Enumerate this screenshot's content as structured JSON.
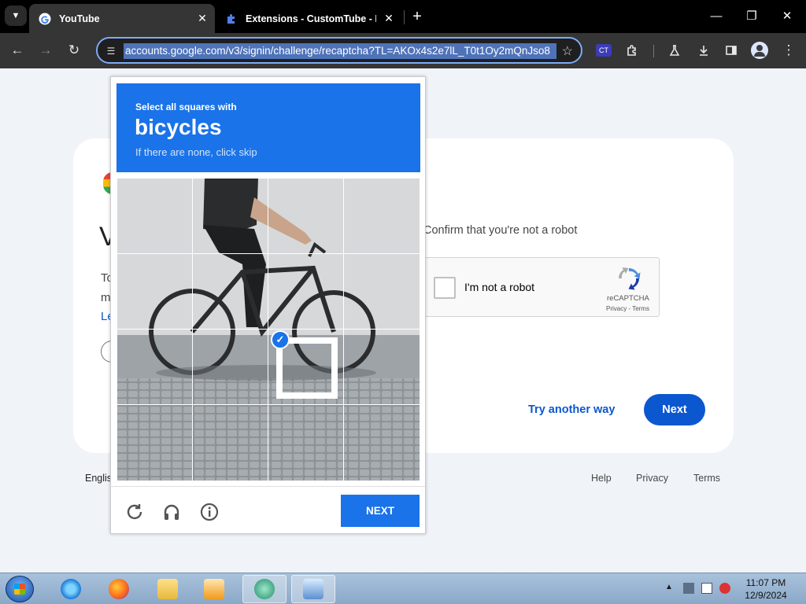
{
  "browser": {
    "tabs": [
      {
        "title": "YouTube",
        "active": true,
        "icon": "google-g-icon"
      },
      {
        "title": "Extensions - CustomTube - Re",
        "active": false,
        "icon": "puzzle-icon"
      }
    ],
    "new_tab": "+",
    "window_controls": {
      "minimize": "—",
      "restore": "❐",
      "close": "✕"
    },
    "url": "accounts.google.com/v3/signin/challenge/recaptcha?TL=AKOx4s2e7lL_T0t1Oy2mQnJso8",
    "nav": {
      "back": "←",
      "forward": "→",
      "reload": "↻"
    },
    "ext_badge": "CT",
    "accent_color": "#7cacf8"
  },
  "page": {
    "heading_fragment": "V",
    "text_fragment1": "To",
    "text_fragment2": "m",
    "link_fragment": "Le",
    "confirm_text": "Confirm that you're not a robot",
    "recaptcha": {
      "label": "I'm not a robot",
      "brand": "reCAPTCHA",
      "terms": "Privacy - Terms"
    },
    "try_another": "Try another way",
    "next": "Next",
    "footer": {
      "language": "Englis",
      "help": "Help",
      "privacy": "Privacy",
      "terms": "Terms"
    },
    "primary_color": "#0b57d0"
  },
  "challenge": {
    "instruction": "Select all squares with",
    "object": "bicycles",
    "hint": "If there are none, click skip",
    "grid_rows": 4,
    "grid_cols": 4,
    "selected_tiles": [
      [
        2,
        2
      ]
    ],
    "buttons": {
      "reload": "reload-icon",
      "audio": "headphones-icon",
      "info": "info-icon",
      "next": "NEXT"
    },
    "header_color": "#1a73e8"
  },
  "taskbar": {
    "apps": [
      "internet-explorer",
      "firefox",
      "file-explorer",
      "media-player",
      "browser-app",
      "remote-desktop"
    ],
    "time": "11:07 PM",
    "date": "12/9/2024"
  }
}
